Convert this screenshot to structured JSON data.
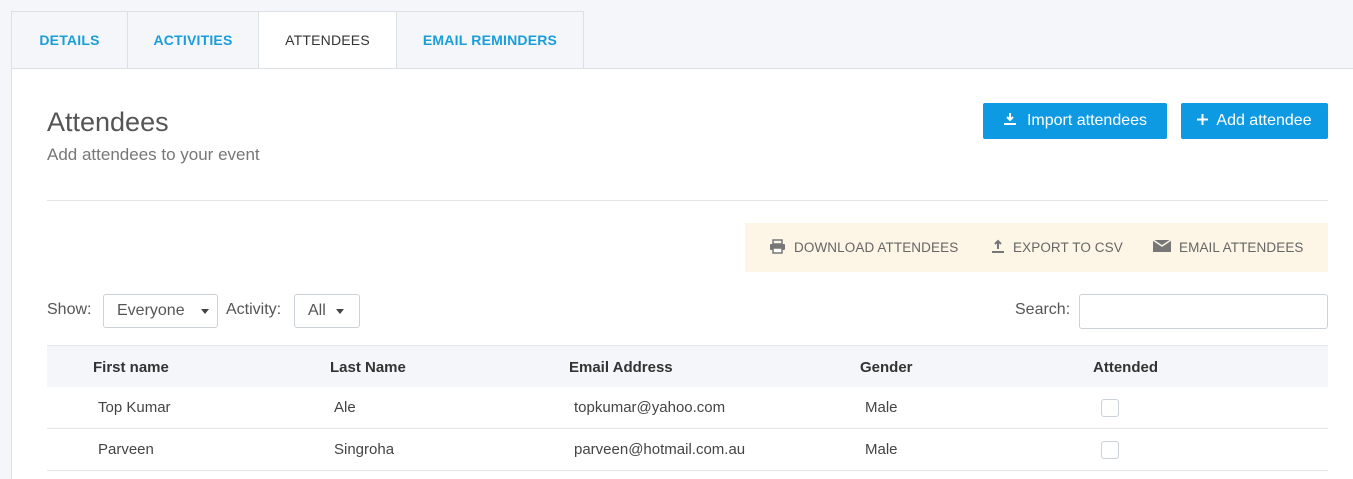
{
  "tabs": [
    {
      "label": "DETAILS",
      "active": false
    },
    {
      "label": "ACTIVITIES",
      "active": false
    },
    {
      "label": "ATTENDEES",
      "active": true
    },
    {
      "label": "EMAIL REMINDERS",
      "active": false
    }
  ],
  "header": {
    "title": "Attendees",
    "subtitle": "Add attendees to your event",
    "import_button": {
      "label": "Import attendees",
      "icon": "download-icon"
    },
    "add_button": {
      "label": "Add attendee",
      "icon": "plus-icon"
    }
  },
  "actions": [
    {
      "label": "DOWNLOAD ATTENDEES",
      "icon": "printer-icon"
    },
    {
      "label": "EXPORT TO CSV",
      "icon": "upload-icon"
    },
    {
      "label": "EMAIL ATTENDEES",
      "icon": "envelope-icon"
    }
  ],
  "filters": {
    "show_label": "Show:",
    "show_value": "Everyone",
    "activity_label": "Activity:",
    "activity_value": "All",
    "search_label": "Search:",
    "search_value": ""
  },
  "table": {
    "columns": [
      "First name",
      "Last Name",
      "Email Address",
      "Gender",
      "Attended"
    ],
    "rows": [
      {
        "first": "Top Kumar",
        "last": "Ale",
        "email": "topkumar@yahoo.com",
        "gender": "Male",
        "attended": false
      },
      {
        "first": "Parveen",
        "last": "Singroha",
        "email": "parveen@hotmail.com.au",
        "gender": "Male",
        "attended": false
      }
    ]
  },
  "colors": {
    "accent": "#0e9ae3",
    "tab_link": "#1a9ed9",
    "action_bar_bg": "#fdf5e6"
  }
}
